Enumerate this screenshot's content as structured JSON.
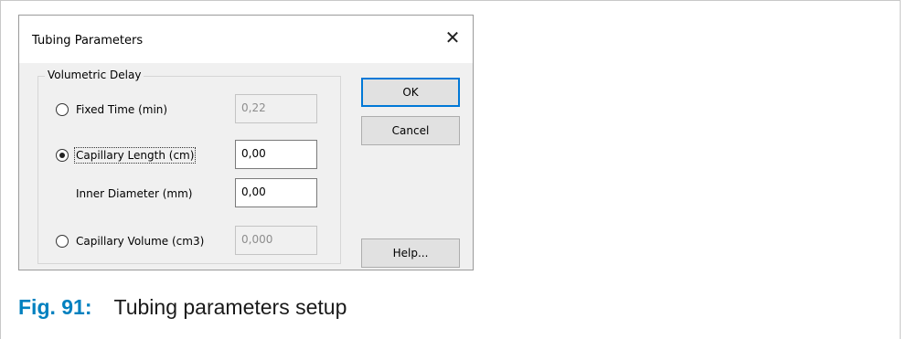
{
  "dialog": {
    "title": "Tubing Parameters",
    "close_glyph": "✕",
    "group_label": "Volumetric Delay",
    "fixed_time": {
      "label": "Fixed Time (min)",
      "value": "0,22",
      "selected": false,
      "enabled": false
    },
    "capillary_length": {
      "label": "Capillary Length (cm)",
      "value": "0,00",
      "selected": true,
      "enabled": true
    },
    "inner_diameter": {
      "label": "Inner Diameter (mm)",
      "value": "0,00",
      "enabled": true
    },
    "capillary_volume": {
      "label": "Capillary Volume (cm3)",
      "value": "0,000",
      "selected": false,
      "enabled": false
    },
    "buttons": {
      "ok": "OK",
      "cancel": "Cancel",
      "help": "Help..."
    }
  },
  "caption": {
    "number": "Fig. 91:",
    "text": "Tubing parameters setup"
  },
  "colors": {
    "caption_accent": "#0080bf",
    "default_button_border": "#0078d7"
  },
  "icons": {
    "close": "close-icon",
    "radio": "radio-icon"
  }
}
